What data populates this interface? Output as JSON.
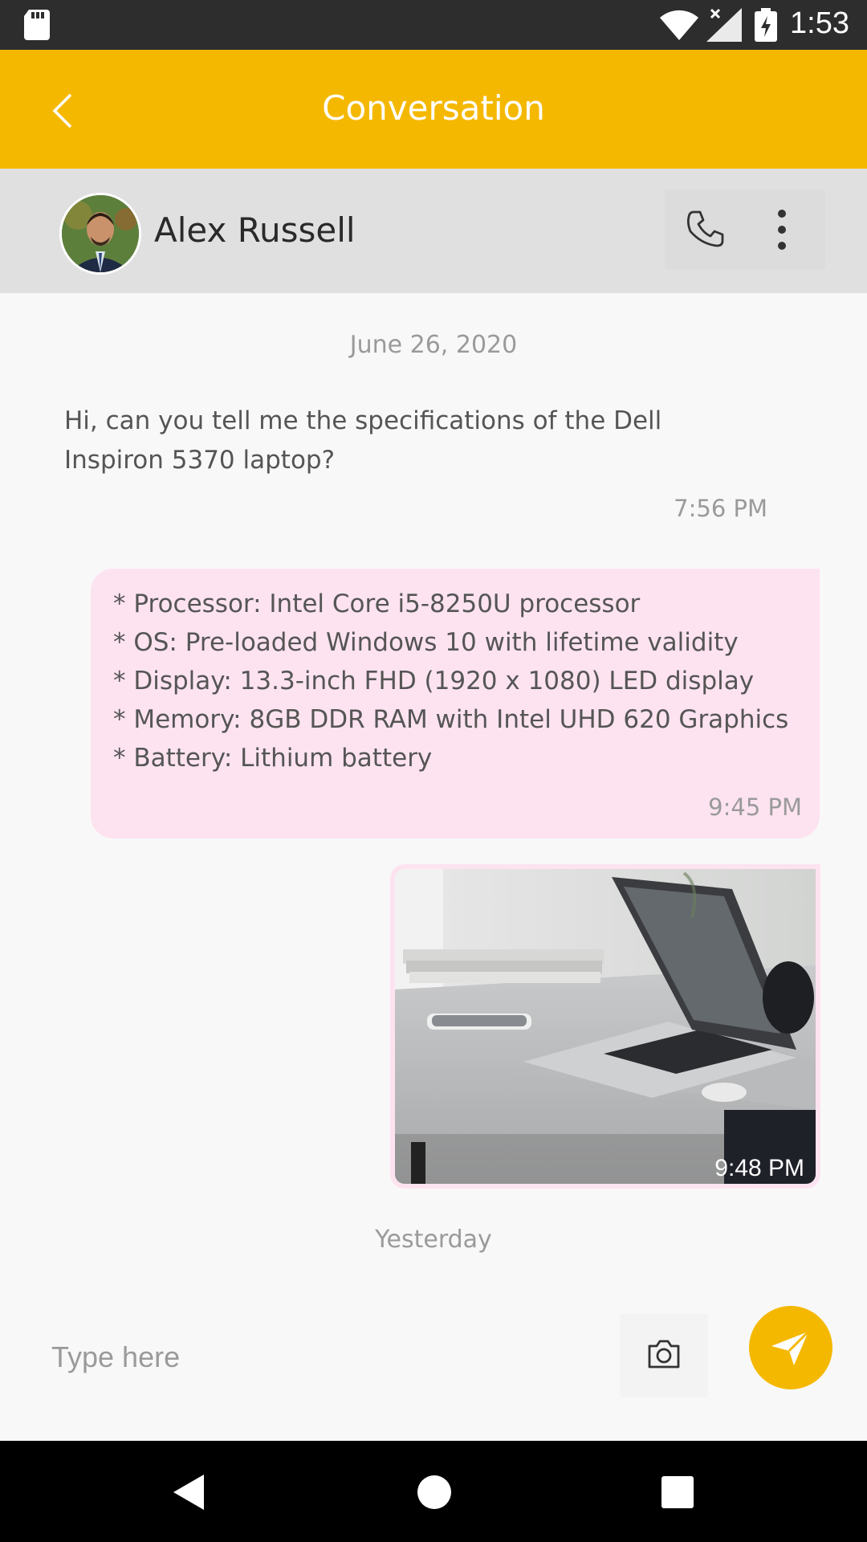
{
  "status_bar": {
    "time": "1:53"
  },
  "app_bar": {
    "title": "Conversation"
  },
  "contact": {
    "name": "Alex Russell"
  },
  "conversation": {
    "date_separator_1": "June 26, 2020",
    "incoming": {
      "text": "Hi, can you tell me the specifications of the Dell Inspiron 5370 laptop?",
      "time": "7:56 PM"
    },
    "outgoing_specs": {
      "lines": [
        "* Processor: Intel Core i5-8250U processor",
        "* OS: Pre-loaded Windows 10 with lifetime validity",
        "* Display: 13.3-inch FHD (1920 x 1080) LED display",
        "* Memory: 8GB DDR RAM with Intel UHD 620 Graphics",
        "* Battery: Lithium battery"
      ],
      "time": "9:45 PM"
    },
    "outgoing_image": {
      "time": "9:48 PM"
    },
    "date_separator_2": "Yesterday"
  },
  "composer": {
    "placeholder": "Type here"
  },
  "colors": {
    "accent": "#f5b800",
    "outgoing_bubble": "#fde3f0",
    "header_bg": "#e0e0e0"
  }
}
